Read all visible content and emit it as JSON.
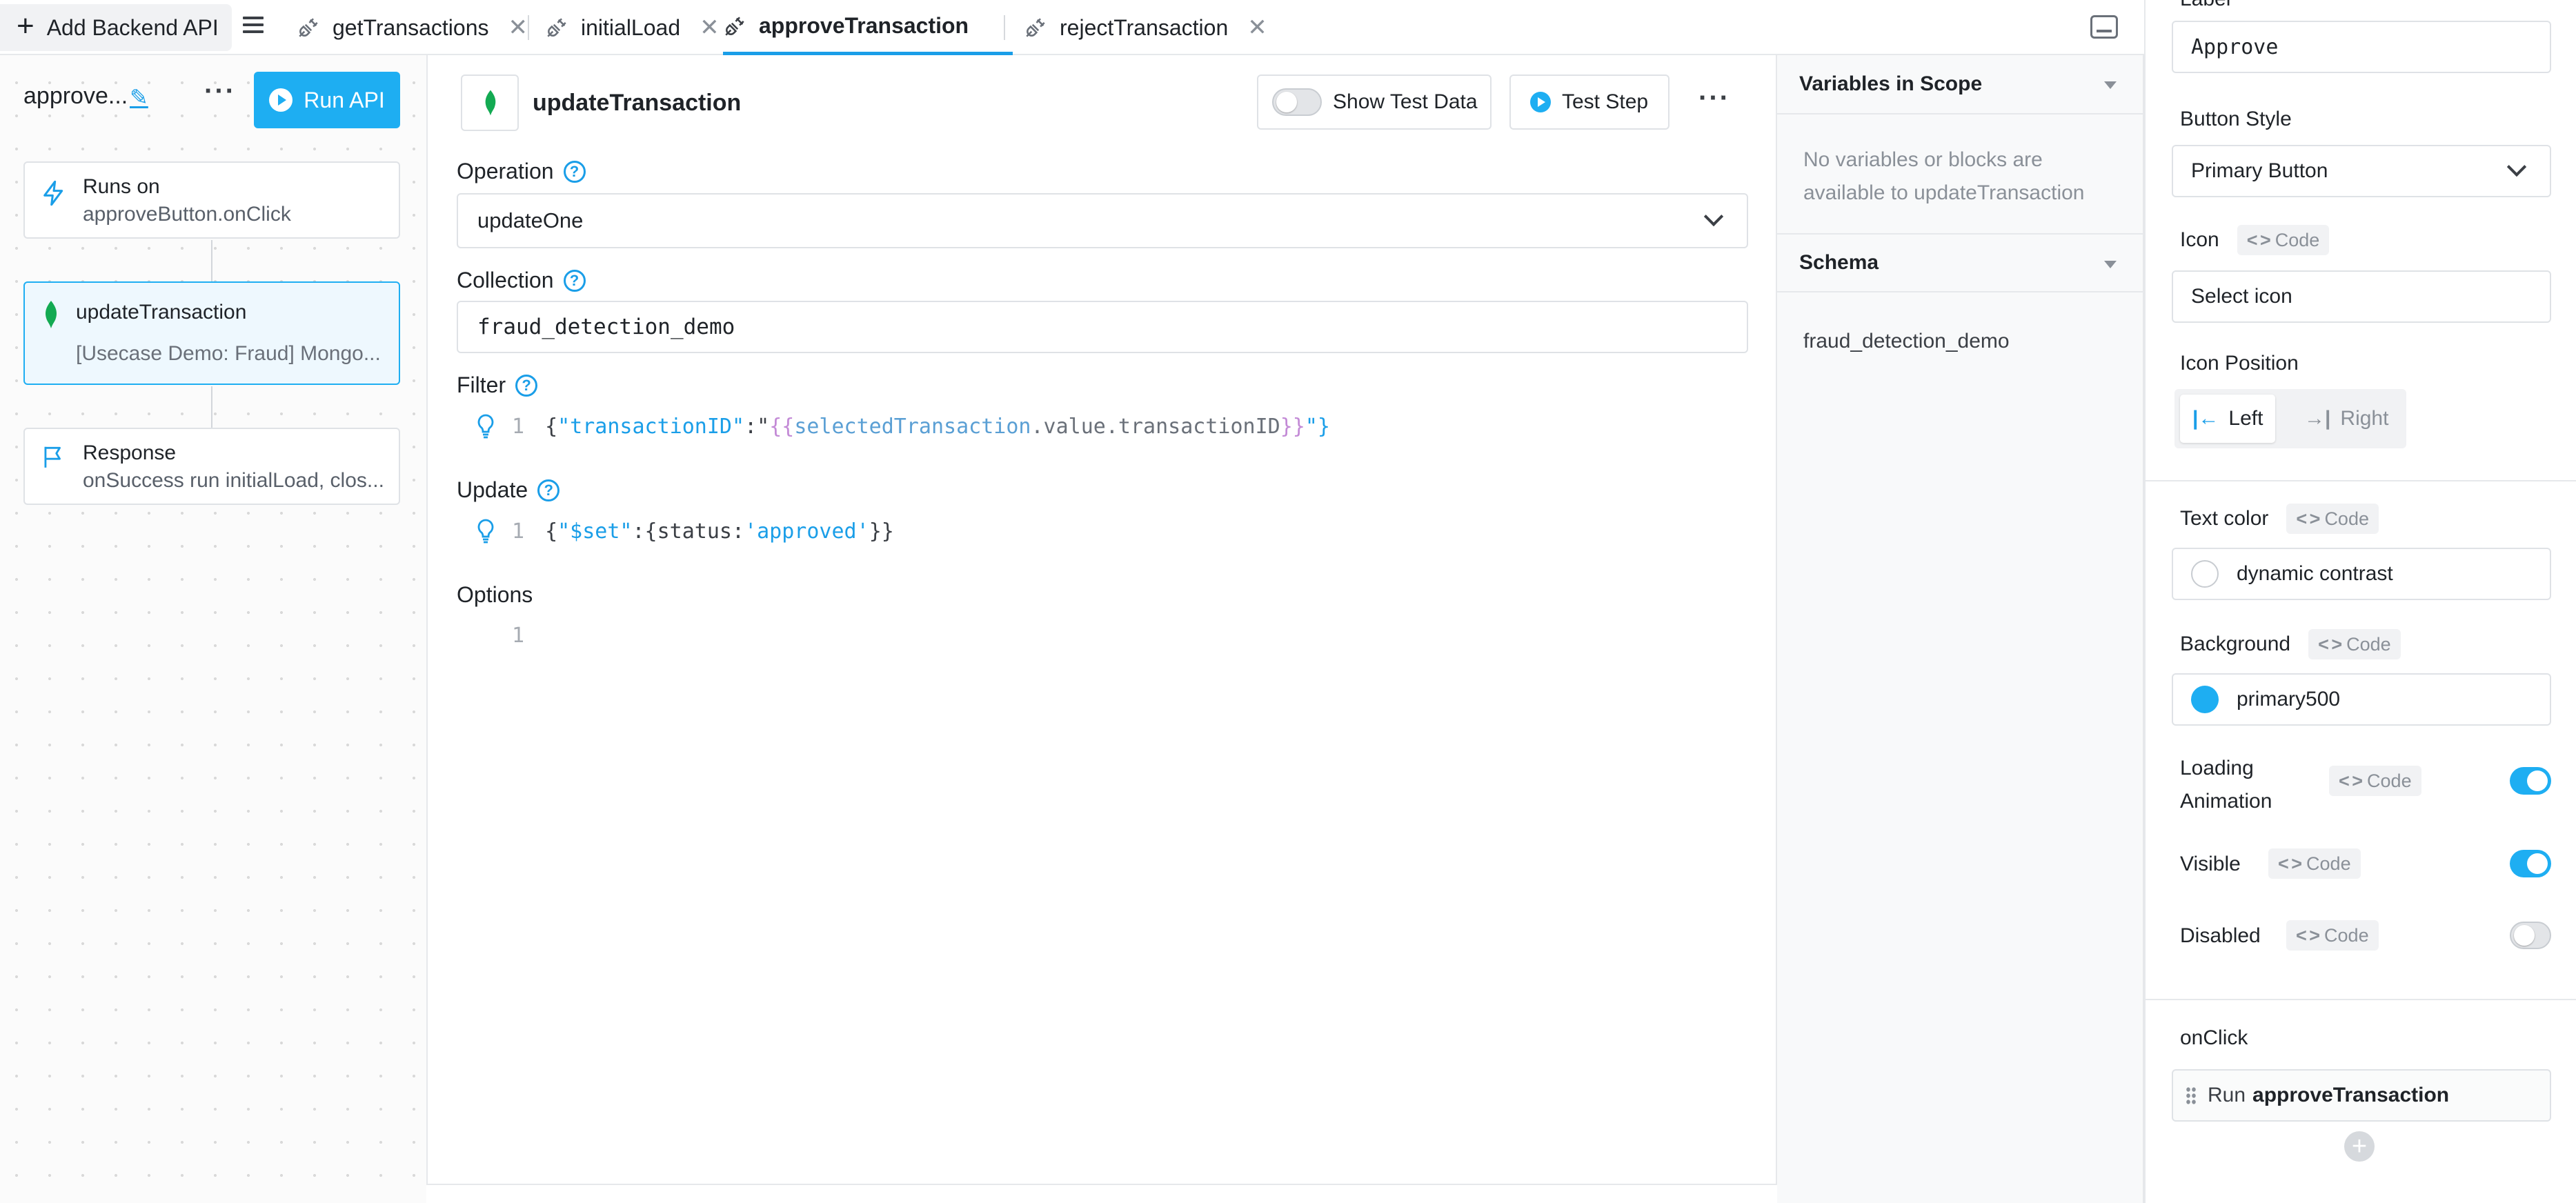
{
  "tabbar": {
    "add_label": "Add Backend API",
    "tabs": [
      {
        "label": "getTransactions"
      },
      {
        "label": "initialLoad"
      },
      {
        "label": "approveTransaction"
      },
      {
        "label": "rejectTransaction"
      }
    ]
  },
  "api": {
    "name": "approve...",
    "run_label": "Run API"
  },
  "flow": {
    "trigger": {
      "title": "Runs on",
      "detail": "approveButton.onClick"
    },
    "step": {
      "title": "updateTransaction",
      "detail": "[Usecase Demo: Fraud] Mongo..."
    },
    "response": {
      "title": "Response",
      "detail": "onSuccess run initialLoad, clos..."
    }
  },
  "editor": {
    "step_name": "updateTransaction",
    "show_test_data_label": "Show Test Data",
    "test_step_label": "Test Step",
    "operation_label": "Operation",
    "operation_value": "updateOne",
    "collection_label": "Collection",
    "collection_value": "fraud_detection_demo",
    "filter_label": "Filter",
    "filter_line_no": "1",
    "filter_code": {
      "open": "{",
      "key": "\"transactionID\"",
      "colon": ":\"",
      "mus_open": "{{",
      "expr_a": "selectedTransaction",
      "expr_b": ".value.transactionID",
      "mus_close": "}}",
      "close": "\"}"
    },
    "update_label": "Update",
    "update_line_no": "1",
    "update_code": {
      "open": "{",
      "key": "\"$set\"",
      "mid": ":{status:",
      "val": "'approved'",
      "close": "}}"
    },
    "options_label": "Options",
    "options_line_no": "1"
  },
  "vars_panel": {
    "scope_title": "Variables in Scope",
    "scope_empty": "No variables or blocks are available to updateTransaction",
    "schema_title": "Schema",
    "schema_items": [
      "fraud_detection_demo"
    ]
  },
  "props": {
    "label_title": "Label",
    "label_value": "Approve",
    "button_style_title": "Button Style",
    "button_style_value": "Primary Button",
    "icon_title": "Icon",
    "code_tag": "Code",
    "icon_placeholder": "Select icon",
    "icon_position_title": "Icon Position",
    "icon_position_left": "Left",
    "icon_position_right": "Right",
    "text_color_title": "Text color",
    "text_color_value": "dynamic contrast",
    "background_title": "Background",
    "background_value": "primary500",
    "background_color": "#1eaef2",
    "loading_title": "Loading Animation",
    "loading_on": true,
    "visible_title": "Visible",
    "visible_on": true,
    "disabled_title": "Disabled",
    "disabled_on": false,
    "onclick_title": "onClick",
    "onclick_prefix": "Run",
    "onclick_target": "approveTransaction"
  },
  "colors": {
    "accent": "#1eaef2",
    "mongo_leaf": "#13aa52"
  }
}
